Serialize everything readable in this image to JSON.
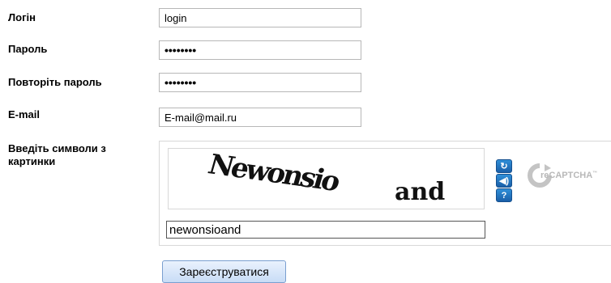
{
  "form": {
    "login_label": "Логін",
    "login_value": "login",
    "password_label": "Пароль",
    "password_value": "••••••••",
    "repeat_label": "Повторіть пароль",
    "repeat_value": "••••••••",
    "email_label": "E-mail",
    "email_value": "E-mail@mail.ru",
    "captcha_label": "Введіть символи з картинки",
    "captcha_input_value": "newonsioand",
    "captcha_word1": "Newonsio",
    "captcha_word2": "and",
    "recaptcha_brand": "reCAPTCHA",
    "recaptcha_tm": "™",
    "submit_label": "Зареєструватися"
  },
  "icons": {
    "refresh": "refresh-icon",
    "audio": "audio-icon",
    "help": "help-icon"
  },
  "colors": {
    "button_blue": "#1a5fa8",
    "recaptcha_grey": "#b8b8b8"
  }
}
